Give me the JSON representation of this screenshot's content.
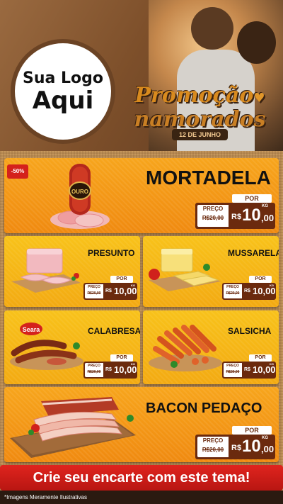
{
  "header": {
    "logo_line1": "Sua Logo",
    "logo_line2": "Aqui",
    "promo_word1": "Promoção",
    "promo_word2": "namorados",
    "date": "12 DE JUNHO"
  },
  "products": {
    "featured": {
      "badge": "-50%",
      "name": "MORTADELA",
      "por_label": "POR",
      "preco_label": "PREÇO",
      "old_price": "R$20,00",
      "currency": "R$",
      "price_int": "10",
      "price_dec": ",00",
      "unit": "KG"
    },
    "presunto": {
      "name": "PRESUNTO",
      "por_label": "POR",
      "preco_label": "PREÇO",
      "old_price": "R$20,00",
      "currency": "R$",
      "price": "10,00",
      "unit": "KG"
    },
    "mussarela": {
      "name": "MUSSARELA",
      "por_label": "POR",
      "preco_label": "PREÇO",
      "old_price": "R$20,00",
      "currency": "R$",
      "price": "10,00",
      "unit": "KG"
    },
    "calabresa": {
      "name": "CALABRESA",
      "brand": "Seara",
      "por_label": "POR",
      "preco_label": "PREÇO",
      "old_price": "R$20,00",
      "currency": "R$",
      "price": "10,00",
      "unit": "KG"
    },
    "salsicha": {
      "name": "SALSICHA",
      "por_label": "POR",
      "preco_label": "PREÇO",
      "old_price": "R$20,00",
      "currency": "R$",
      "price": "10,00",
      "unit": "KG"
    },
    "bacon": {
      "name": "BACON PEDAÇO",
      "por_label": "POR",
      "preco_label": "PREÇO",
      "old_price": "R$20,00",
      "currency": "R$",
      "price_int": "10",
      "price_dec": ",00",
      "unit": "KG"
    }
  },
  "cta": {
    "label": "Crie seu encarte com este tema!"
  },
  "footer": {
    "note": "*Imagens Meramente Ilustrativas"
  },
  "colors": {
    "orange": "#f39414",
    "yellow": "#f6b816",
    "price_brown": "#6b2a0e",
    "cta_red": "#d01e18"
  }
}
